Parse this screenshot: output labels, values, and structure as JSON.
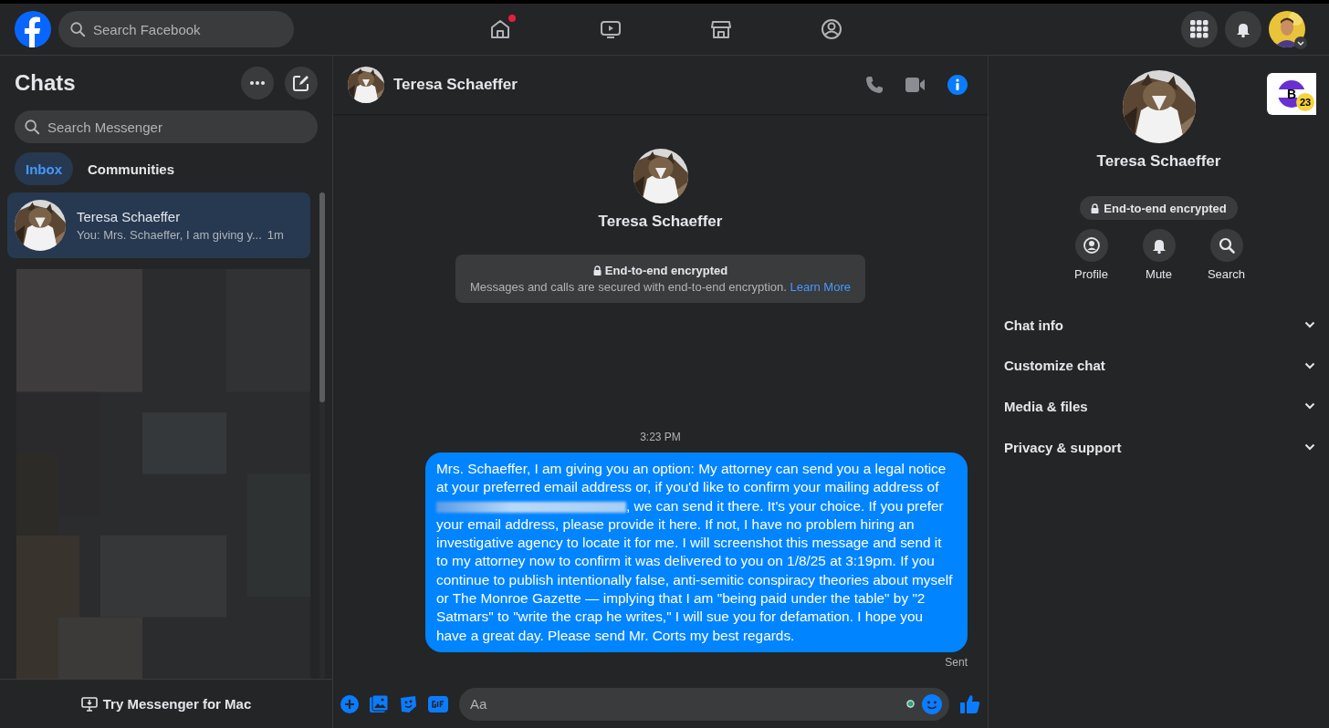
{
  "top_bar": {
    "search": {
      "placeholder": "Search Facebook"
    },
    "nav": [
      {
        "kind": "home",
        "notification": true
      },
      {
        "kind": "video",
        "notification": false
      },
      {
        "kind": "marketplace",
        "notification": false
      },
      {
        "kind": "groups",
        "notification": false
      }
    ]
  },
  "sidebar": {
    "title": "Chats",
    "search": {
      "placeholder": "Search Messenger"
    },
    "tabs": [
      {
        "label": "Inbox",
        "selected": true
      },
      {
        "label": "Communities",
        "selected": false
      }
    ],
    "chats": [
      {
        "name": "Teresa Schaeffer",
        "preview": "You: Mrs. Schaeffer, I am giving y...",
        "time": "1m",
        "selected": true
      }
    ],
    "footer": "Try Messenger for Mac"
  },
  "conversation": {
    "header": {
      "name": "Teresa Schaeffer"
    },
    "intro": {
      "name": "Teresa Schaeffer",
      "encryption_title": "End-to-end encrypted",
      "encryption_text": "Messages and calls are secured with end-to-end encryption.",
      "link": "Learn More"
    },
    "timestamp": "3:23 PM",
    "messages": [
      {
        "before": "Mrs. Schaeffer, I am giving you an option: My attorney can send you a legal notice at your preferred email address or, if you'd like to confirm your mailing address of ",
        "after": ", we can send it there. It's your choice. If you prefer your email address, please provide it here. If not, I have no problem hiring an investigative agency to locate it for me. I will screenshot this message and send it to my attorney now to confirm it was delivered to you on 1/8/25 at 3:19pm. If you continue to publish intentionally false, anti-semitic conspiracy theories about myself or The Monroe Gazette — implying that I am \"being paid under the table\" by \"2 Satmars\" to \"write the crap he writes,\" I will sue you for defamation. I hope you have a great day. Please send Mr. Corts my best regards.",
        "status": "Sent"
      }
    ],
    "composer": {
      "placeholder": "Aa"
    }
  },
  "details": {
    "name": "Teresa Schaeffer",
    "badge": "End-to-end encrypted",
    "actions": [
      {
        "kind": "profile",
        "label": "Profile"
      },
      {
        "kind": "mute",
        "label": "Mute"
      },
      {
        "kind": "search",
        "label": "Search"
      }
    ],
    "sections": [
      {
        "label": "Chat info",
        "expanded": false
      },
      {
        "label": "Customize chat",
        "expanded": false
      },
      {
        "label": "Media & files",
        "expanded": false
      },
      {
        "label": "Privacy & support",
        "expanded": false
      }
    ]
  },
  "extension_badge": {
    "letter": "B",
    "count": "23"
  }
}
